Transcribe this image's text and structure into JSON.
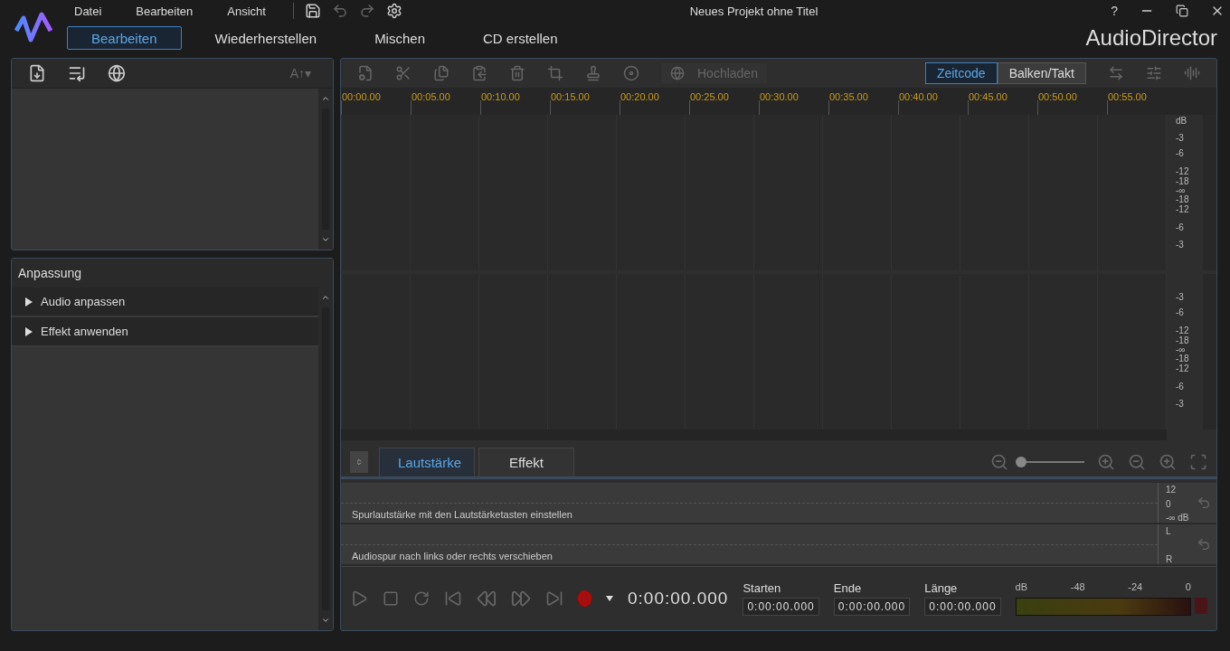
{
  "menu": [
    {
      "label": "Datei"
    },
    {
      "label": "Bearbeiten"
    },
    {
      "label": "Ansicht"
    }
  ],
  "window": {
    "title": "Neues Projekt ohne Titel",
    "help": "?",
    "brand": "AudioDirector"
  },
  "modes": [
    {
      "label": "Bearbeiten",
      "selected": true
    },
    {
      "label": "Wiederherstellen",
      "selected": false
    },
    {
      "label": "Mischen",
      "selected": false
    },
    {
      "label": "CD erstellen",
      "selected": false
    }
  ],
  "media_panel": {
    "sort_label": "A↑▾"
  },
  "adjust_panel": {
    "title": "Anpassung",
    "items": [
      {
        "label": "Audio anpassen",
        "expanded": false
      },
      {
        "label": "Effekt anwenden",
        "expanded": false
      }
    ]
  },
  "toolbar": {
    "upload": "Hochladen",
    "time_modes": [
      {
        "label": "Zeitcode",
        "selected": true
      },
      {
        "label": "Balken/Takt",
        "selected": false
      }
    ]
  },
  "ruler": [
    "00:00.00",
    "00:05.00",
    "00:10.00",
    "00:15.00",
    "00:20.00",
    "00:25.00",
    "00:30.00",
    "00:35.00",
    "00:40.00",
    "00:45.00",
    "00:50.00",
    "00:55.00"
  ],
  "scale_unit": "dB",
  "tracks": [
    {
      "scale": [
        "-3",
        "-6",
        "-12",
        "-18",
        "-∞",
        "-18",
        "-12",
        "-6",
        "-3"
      ]
    },
    {
      "scale": [
        "-3",
        "-6",
        "-12",
        "-18",
        "-∞",
        "-18",
        "-12",
        "-6",
        "-3"
      ]
    }
  ],
  "bottom_tabs": [
    {
      "label": "Lautstärke",
      "selected": true
    },
    {
      "label": "Effekt",
      "selected": false
    }
  ],
  "zoom": {
    "level": 0.0
  },
  "lanes": [
    {
      "hint": "Spurlautstärke mit den Lautstärketasten einstellen",
      "scale": [
        "12",
        "0",
        "-∞ dB"
      ]
    },
    {
      "hint": "Audiospur nach links oder rechts verschieben",
      "scale": [
        "L",
        "R"
      ]
    }
  ],
  "transport": {
    "time": "0:00:00.000",
    "fields": [
      {
        "label": "Starten",
        "value": "0:00:00.000"
      },
      {
        "label": "Ende",
        "value": "0:00:00.000"
      },
      {
        "label": "Länge",
        "value": "0:00:00.000"
      }
    ]
  },
  "meter": {
    "labels": [
      "dB",
      "-48",
      "-24",
      "0"
    ],
    "level": 0.0
  }
}
